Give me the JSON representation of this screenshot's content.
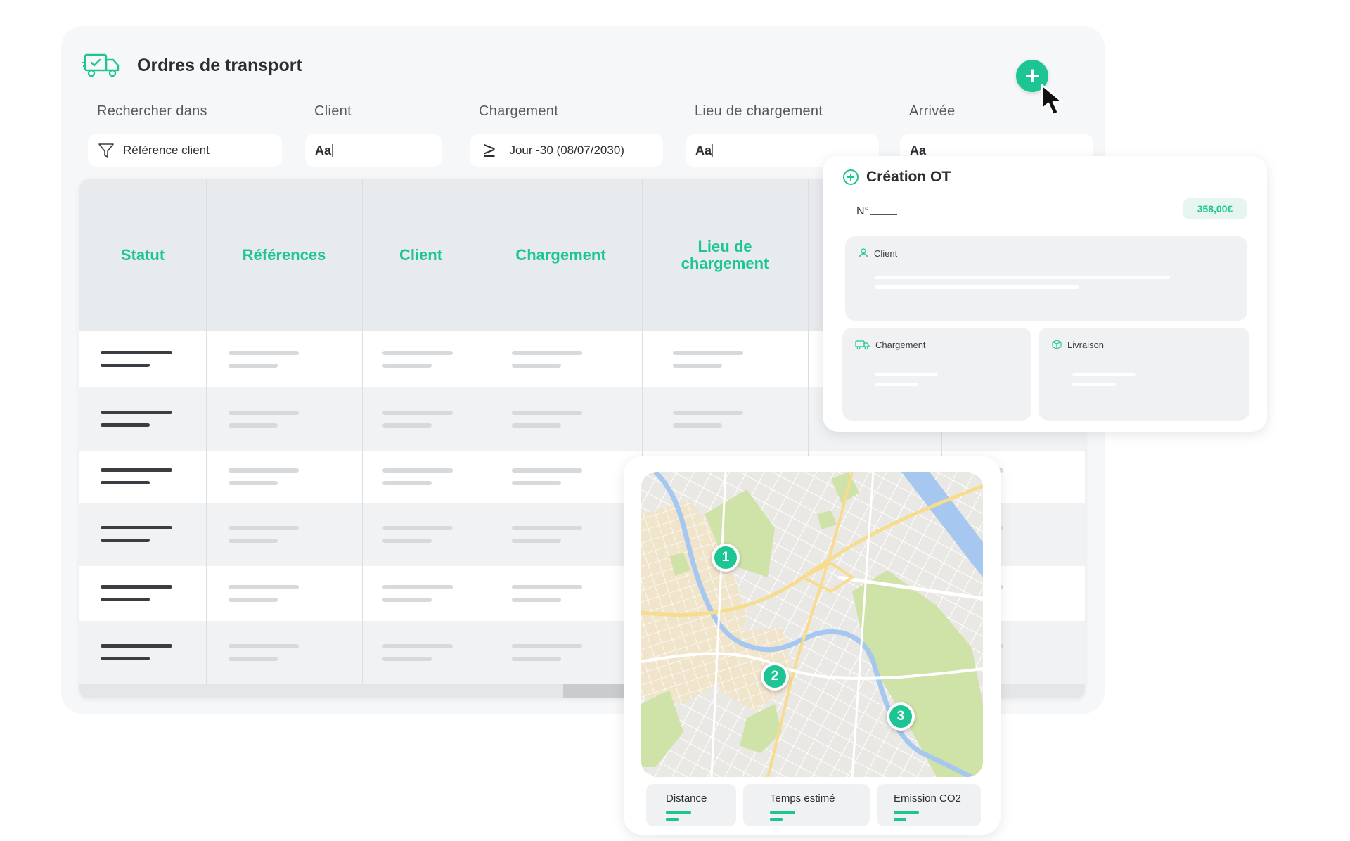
{
  "header": {
    "title": "Ordres de transport",
    "truck_icon": "truck-icon",
    "add_icon": "plus-icon"
  },
  "filters": [
    {
      "label": "Rechercher dans",
      "value": "Référence client",
      "icon": "funnel-icon"
    },
    {
      "label": "Client",
      "value": "Aa"
    },
    {
      "label": "Chargement",
      "value": "Jour -30 (08/07/2030)",
      "icon": "greater-or-equal-icon"
    },
    {
      "label": "Lieu de chargement",
      "value": "Aa"
    },
    {
      "label": "Arrivée",
      "value": "Aa"
    }
  ],
  "table": {
    "columns": [
      "Statut",
      "Références",
      "Client",
      "Chargement",
      "Lieu de\nchargement"
    ]
  },
  "creation": {
    "title": "Création OT",
    "number_label": "N°",
    "price": "358,00€",
    "client_label": "Client",
    "loading_label": "Chargement",
    "delivery_label": "Livraison"
  },
  "map": {
    "markers": [
      "1",
      "2",
      "3"
    ],
    "stats": [
      "Distance",
      "Temps estimé",
      "Emission CO2"
    ]
  },
  "colors": {
    "accent": "#1ec594",
    "panel": "#f6f7f8",
    "header": "#e8ebee"
  }
}
